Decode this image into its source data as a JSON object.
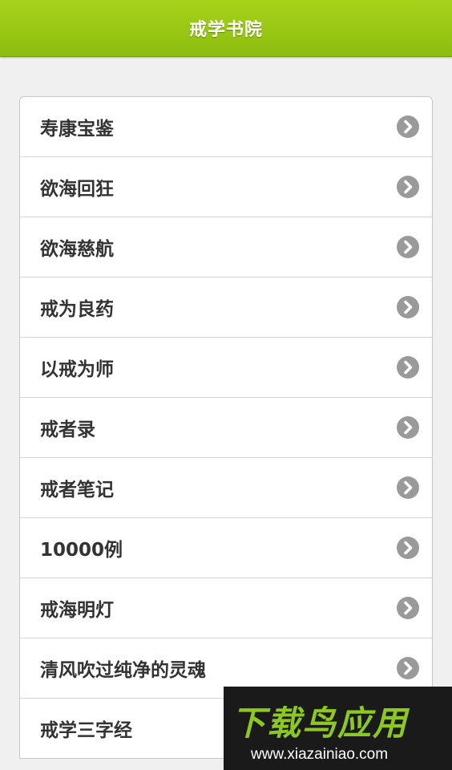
{
  "header": {
    "title": "戒学书院"
  },
  "list": {
    "items": [
      {
        "label": "寿康宝鉴"
      },
      {
        "label": "欲海回狂"
      },
      {
        "label": "欲海慈航"
      },
      {
        "label": "戒为良药"
      },
      {
        "label": "以戒为师"
      },
      {
        "label": "戒者录"
      },
      {
        "label": "戒者笔记"
      },
      {
        "label": "10000例"
      },
      {
        "label": "戒海明灯"
      },
      {
        "label": "清风吹过纯净的灵魂"
      },
      {
        "label": "戒学三字经"
      }
    ]
  },
  "watermark": {
    "title": "下载鸟应用",
    "url": "www.xiazainiao.com"
  },
  "colors": {
    "header": "#9cc814",
    "chevron": "#9a9a9a"
  },
  "icons": {
    "item_icon": "chevron-right-circle-icon"
  }
}
